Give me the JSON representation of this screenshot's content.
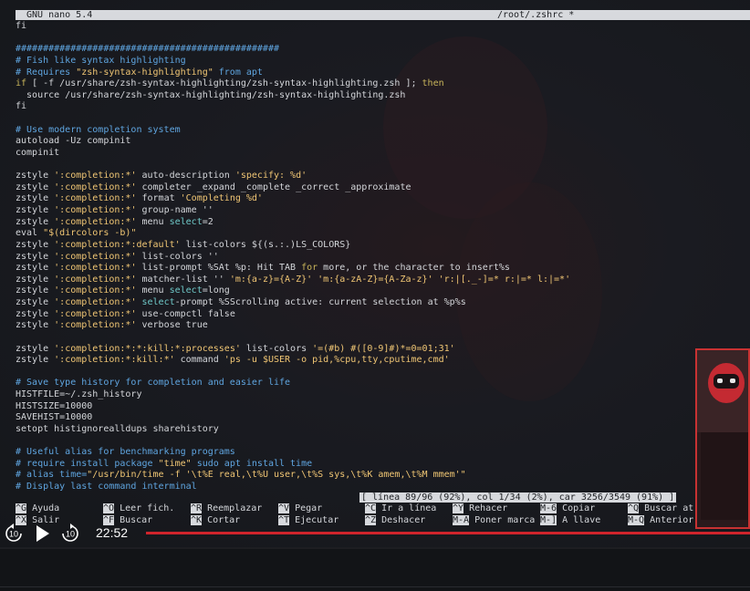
{
  "titlebar": {
    "left": "GNU nano 5.4",
    "center": "/root/.zshrc *"
  },
  "code": {
    "lines": [
      [
        {
          "t": "fi"
        }
      ],
      [
        {
          "t": ""
        }
      ],
      [
        {
          "t": "################################################",
          "c": "c"
        }
      ],
      [
        {
          "t": "# Fish like syntax highlighting",
          "c": "c"
        }
      ],
      [
        {
          "t": "# Requires ",
          "c": "c"
        },
        {
          "t": "\"zsh-syntax-highlighting\"",
          "c": "s"
        },
        {
          "t": " from apt",
          "c": "c"
        }
      ],
      [
        {
          "t": "if",
          "c": "k"
        },
        {
          "t": " [ -f /usr/share/zsh-syntax-highlighting/zsh-syntax-highlighting.zsh ]; "
        },
        {
          "t": "then",
          "c": "k"
        }
      ],
      [
        {
          "t": "  source /usr/share/zsh-syntax-highlighting/zsh-syntax-highlighting.zsh"
        }
      ],
      [
        {
          "t": "fi"
        }
      ],
      [
        {
          "t": ""
        }
      ],
      [
        {
          "t": "# Use modern completion system",
          "c": "c"
        }
      ],
      [
        {
          "t": "autoload -Uz compinit"
        }
      ],
      [
        {
          "t": "compinit"
        }
      ],
      [
        {
          "t": ""
        }
      ],
      [
        {
          "t": "zstyle "
        },
        {
          "t": "':completion:*'",
          "c": "s"
        },
        {
          "t": " auto-description "
        },
        {
          "t": "'specify: %d'",
          "c": "s"
        }
      ],
      [
        {
          "t": "zstyle "
        },
        {
          "t": "':completion:*'",
          "c": "s"
        },
        {
          "t": " completer _expand _complete _correct _approximate"
        }
      ],
      [
        {
          "t": "zstyle "
        },
        {
          "t": "':completion:*'",
          "c": "s"
        },
        {
          "t": " format "
        },
        {
          "t": "'Completing %d'",
          "c": "s"
        }
      ],
      [
        {
          "t": "zstyle "
        },
        {
          "t": "':completion:*'",
          "c": "s"
        },
        {
          "t": " group-name ''"
        }
      ],
      [
        {
          "t": "zstyle "
        },
        {
          "t": "':completion:*'",
          "c": "s"
        },
        {
          "t": " menu "
        },
        {
          "t": "select",
          "c": "cy"
        },
        {
          "t": "=2"
        }
      ],
      [
        {
          "t": "eval "
        },
        {
          "t": "\"$(dircolors -b)\"",
          "c": "s"
        }
      ],
      [
        {
          "t": "zstyle "
        },
        {
          "t": "':completion:*:default'",
          "c": "s"
        },
        {
          "t": " list-colors ${(s.:.)LS_COLORS}"
        }
      ],
      [
        {
          "t": "zstyle "
        },
        {
          "t": "':completion:*'",
          "c": "s"
        },
        {
          "t": " list-colors ''"
        }
      ],
      [
        {
          "t": "zstyle "
        },
        {
          "t": "':completion:*'",
          "c": "s"
        },
        {
          "t": " list-prompt %SAt %p: Hit TAB "
        },
        {
          "t": "for",
          "c": "k"
        },
        {
          "t": " more, or the character to insert%s"
        }
      ],
      [
        {
          "t": "zstyle "
        },
        {
          "t": "':completion:*'",
          "c": "s"
        },
        {
          "t": " matcher-list '' "
        },
        {
          "t": "'m:{a-z}={A-Z}' 'm:{a-zA-Z}={A-Za-z}' 'r:|[._-]=* r:|=* l:|=*'",
          "c": "s"
        }
      ],
      [
        {
          "t": "zstyle "
        },
        {
          "t": "':completion:*'",
          "c": "s"
        },
        {
          "t": " menu "
        },
        {
          "t": "select",
          "c": "cy"
        },
        {
          "t": "=long"
        }
      ],
      [
        {
          "t": "zstyle "
        },
        {
          "t": "':completion:*'",
          "c": "s"
        },
        {
          "t": " "
        },
        {
          "t": "select",
          "c": "cy"
        },
        {
          "t": "-prompt %SScrolling active: current selection at %p%s"
        }
      ],
      [
        {
          "t": "zstyle "
        },
        {
          "t": "':completion:*'",
          "c": "s"
        },
        {
          "t": " use-compctl false"
        }
      ],
      [
        {
          "t": "zstyle "
        },
        {
          "t": "':completion:*'",
          "c": "s"
        },
        {
          "t": " verbose true"
        }
      ],
      [
        {
          "t": ""
        }
      ],
      [
        {
          "t": "zstyle "
        },
        {
          "t": "':completion:*:*:kill:*:processes'",
          "c": "s"
        },
        {
          "t": " list-colors "
        },
        {
          "t": "'=(#b) #([0-9]#)*=0=01;31'",
          "c": "s"
        }
      ],
      [
        {
          "t": "zstyle "
        },
        {
          "t": "':completion:*:kill:*'",
          "c": "s"
        },
        {
          "t": " command "
        },
        {
          "t": "'ps -u $USER -o pid,%cpu,tty,cputime,cmd'",
          "c": "s"
        }
      ],
      [
        {
          "t": ""
        }
      ],
      [
        {
          "t": "# Save type history for completion and easier life",
          "c": "c"
        }
      ],
      [
        {
          "t": "HISTFILE=~/.zsh_history"
        }
      ],
      [
        {
          "t": "HISTSIZE=10000"
        }
      ],
      [
        {
          "t": "SAVEHIST=10000"
        }
      ],
      [
        {
          "t": "setopt histignorealldups sharehistory"
        }
      ],
      [
        {
          "t": ""
        }
      ],
      [
        {
          "t": "# Useful alias for benchmarking programs",
          "c": "c"
        }
      ],
      [
        {
          "t": "# require install package ",
          "c": "c"
        },
        {
          "t": "\"time\"",
          "c": "s"
        },
        {
          "t": " sudo apt install time",
          "c": "c"
        }
      ],
      [
        {
          "t": "# alias time=",
          "c": "c"
        },
        {
          "t": "\"/usr/bin/time -f '\\t%E real,\\t%U user,\\t%S sys,\\t%K amem,\\t%M mmem'\"",
          "c": "s"
        }
      ],
      [
        {
          "t": "# Display last command interminal",
          "c": "c"
        }
      ]
    ]
  },
  "status": "[ línea 89/96 (92%), col 1/34 (2%), car 3256/3549 (91%) ]",
  "shortcuts": {
    "row1": [
      {
        "key": "^G",
        "label": "Ayuda"
      },
      {
        "key": "^O",
        "label": "Leer fich."
      },
      {
        "key": "^R",
        "label": "Reemplazar"
      },
      {
        "key": "^V",
        "label": "Pegar"
      },
      {
        "key": "^C",
        "label": "Ir a línea"
      },
      {
        "key": "^Y",
        "label": "Rehacer"
      },
      {
        "key": "M-6",
        "label": "Copiar"
      },
      {
        "key": "^Q",
        "label": "Buscar atr"
      }
    ],
    "row2": [
      {
        "key": "^X",
        "label": "Salir"
      },
      {
        "key": "^F",
        "label": "Buscar"
      },
      {
        "key": "^K",
        "label": "Cortar"
      },
      {
        "key": "^T",
        "label": "Ejecutar"
      },
      {
        "key": "^Z",
        "label": "Deshacer"
      },
      {
        "key": "M-A",
        "label": "Poner marca"
      },
      {
        "key": "M-]",
        "label": "A llave"
      },
      {
        "key": "M-Q",
        "label": "Anterior"
      }
    ]
  },
  "player": {
    "rewind_label": "10",
    "forward_label": "10",
    "timecode": "22:52",
    "progress_color": "#d0242c"
  }
}
